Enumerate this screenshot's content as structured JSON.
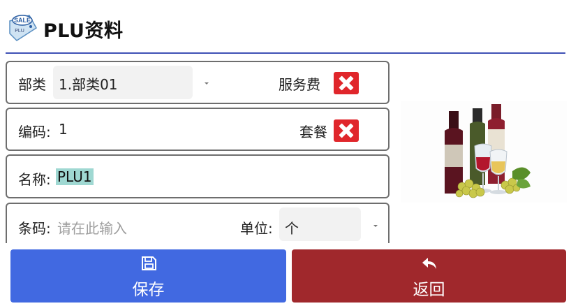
{
  "header": {
    "title": "PLU资料",
    "logo": {
      "icon": "sale-tag-logo",
      "badge_text": "SALE",
      "tag_text": "PLU"
    }
  },
  "form": {
    "category": {
      "label": "部类",
      "value": "1.部类01"
    },
    "service_fee": {
      "label": "服务费",
      "checked": false
    },
    "code": {
      "label": "编码:",
      "value": "1"
    },
    "combo": {
      "label": "套餐",
      "checked": false
    },
    "name": {
      "label": "名称:",
      "value": "PLU1"
    },
    "barcode": {
      "label": "条码:",
      "placeholder": "请在此输入"
    },
    "unit": {
      "label": "单位:",
      "value": "个"
    }
  },
  "image": {
    "description_icon": "wine-bottles-image"
  },
  "buttons": {
    "save": {
      "label": "保存",
      "icon": "save-icon"
    },
    "back": {
      "label": "返回",
      "icon": "reply-arrow-icon"
    }
  },
  "colors": {
    "header_divider": "#3f51b5",
    "save_button": "#4169e1",
    "back_button": "#a0282c",
    "checkbox_off": "#e0262b",
    "selection_highlight": "#9fd8d2"
  }
}
